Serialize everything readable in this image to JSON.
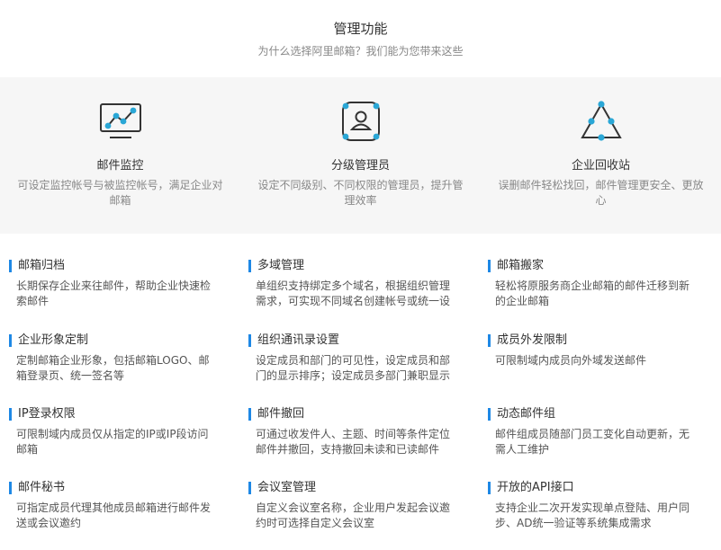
{
  "header": {
    "title": "管理功能",
    "subtitle": "为什么选择阿里邮箱？我们能为您带来这些"
  },
  "features": [
    {
      "icon": "monitor-chart-icon",
      "title": "邮件监控",
      "desc": "可设定监控帐号与被监控帐号，满足企业对邮箱"
    },
    {
      "icon": "admin-user-icon",
      "title": "分级管理员",
      "desc": "设定不同级别、不同权限的管理员，提升管理效率"
    },
    {
      "icon": "recycle-triangle-icon",
      "title": "企业回收站",
      "desc": "误删邮件轻松找回，邮件管理更安全、更放心"
    }
  ],
  "items": [
    {
      "title": "邮箱归档",
      "desc": "长期保存企业来往邮件，帮助企业快速检索邮件"
    },
    {
      "title": "多域管理",
      "desc": "单组织支持绑定多个域名，根据组织管理需求，可实现不同域名创建帐号或统一设"
    },
    {
      "title": "邮箱搬家",
      "desc": "轻松将原服务商企业邮箱的邮件迁移到新的企业邮箱"
    },
    {
      "title": "企业形象定制",
      "desc": "定制邮箱企业形象，包括邮箱LOGO、邮箱登录页、统一签名等"
    },
    {
      "title": "组织通讯录设置",
      "desc": "设定成员和部门的可见性，设定成员和部门的显示排序；设定成员多部门兼职显示"
    },
    {
      "title": "成员外发限制",
      "desc": "可限制域内成员向外域发送邮件"
    },
    {
      "title": "IP登录权限",
      "desc": "可限制域内成员仅从指定的IP或IP段访问邮箱"
    },
    {
      "title": "邮件撤回",
      "desc": "可通过收发件人、主题、时间等条件定位邮件并撤回，支持撤回未读和已读邮件"
    },
    {
      "title": "动态邮件组",
      "desc": "邮件组成员随部门员工变化自动更新，无需人工维护"
    },
    {
      "title": "邮件秘书",
      "desc": "可指定成员代理其他成员邮箱进行邮件发送或会议邀约"
    },
    {
      "title": "会议室管理",
      "desc": "自定义会议室名称，企业用户发起会议邀约时可选择自定义会议室"
    },
    {
      "title": "开放的API接口",
      "desc": "支持企业二次开发实现单点登陆、用户同步、AD统一验证等系统集成需求"
    }
  ],
  "colors": {
    "accent": "#1e88e5",
    "icon_dot": "#2aa7d6",
    "icon_stroke": "#333333",
    "panel_bg": "#f6f6f6"
  }
}
